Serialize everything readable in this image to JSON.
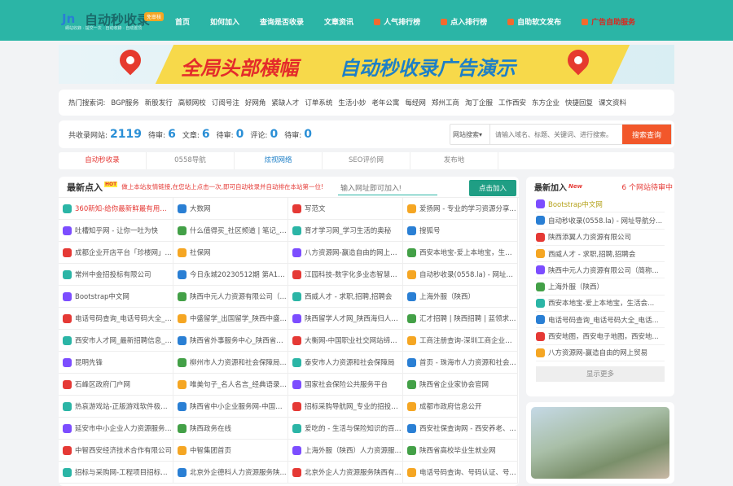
{
  "header": {
    "logo_text": "自动秒收录",
    "logo_badge": "免审核",
    "logo_slogan": "網站收錄 · 提交一次 · 自动收錄 · 自动置顶",
    "nav": [
      {
        "label": "首页",
        "icon": null
      },
      {
        "label": "如何加入",
        "icon": null
      },
      {
        "label": "查询是否收录",
        "icon": null
      },
      {
        "label": "文章资讯",
        "icon": null
      },
      {
        "label": "人气排行榜",
        "icon": "rss-icon"
      },
      {
        "label": "点入排行榜",
        "icon": "rss-icon"
      },
      {
        "label": "自助软文发布",
        "icon": "rss-icon"
      },
      {
        "label": "广告自助服务",
        "icon": "rss-icon",
        "color": "#e0241b"
      }
    ]
  },
  "banner": {
    "text1": "全局头部横幅",
    "text2": "自动秒收录广告演示"
  },
  "hot_search": {
    "label": "热门搜索词:",
    "terms": [
      "BGP服务",
      "新股发行",
      "高顿网校",
      "订阅号注",
      "好网角",
      "紧缺人才",
      "订单系统",
      "生活小妙",
      "老年公寓",
      "每经网",
      "郑州工商",
      "淘丁企服",
      "工作西安",
      "东方企业",
      "快捷回复",
      "课文资料"
    ]
  },
  "stats": {
    "sites_label": "共收录网站:",
    "sites": "2119",
    "pending1_label": "待审:",
    "pending1": "6",
    "articles_label": "文章:",
    "articles": "6",
    "pending2_label": "待审:",
    "pending2": "0",
    "comments_label": "评论:",
    "comments": "0",
    "pending3_label": "待审:",
    "pending3": "0"
  },
  "search": {
    "type": "网站搜索",
    "placeholder": "请输入域名、标题、关键词、进行搜索。",
    "button": "搜索查询"
  },
  "tabs": [
    "自动秒收录",
    "0558导航",
    "炫视网络",
    "SEO评价网",
    "发布地"
  ],
  "latest": {
    "title": "最新点入",
    "hot": "HOT",
    "tip": "做上本站友情链接,在您站上点击一次,即可自动收录并自动排在本站第一位!",
    "input_placeholder": "输入网址即可加入!",
    "add_button": "点击加入",
    "rows": [
      [
        "360新知-给你最新鲜最有用的...",
        "大数网",
        "写范文",
        "爱扬网 - 专业的学习资源分享..."
      ],
      [
        "吐槽知乎网 - 让你一吐为快",
        "什么值得买_社区频道 | 笔记_购...",
        "育才学习网_学习生活的奥秘",
        "搜狐号"
      ],
      [
        "成都企业开店平台「珍楼网」...",
        "社保网",
        "八方资源网-赢造自由的网上贸易",
        "西安本地宝-爱上本地宝，生活..."
      ],
      [
        "常州中金招投标有限公司",
        "今日永城20230512期 第A1版:...",
        "江园科技-数字化多业态智慧园区",
        "自动秒收录(0558.la) - 网址导..."
      ],
      [
        "Bootstrap中文网",
        "陕西中元人力资源有限公司（...",
        "西威人才 - 求职,招聘,招聘会",
        "上海外服（陕西）"
      ],
      [
        "电话号码查询_电话号码大全_电...",
        "中盛留学_出国留学_陕西中盛出...",
        "陕西留学人才网_陕西海归人才...",
        "汇才招聘 | 陕西招聘 | 蓝领求职..."
      ],
      [
        "西安市人才网_最新招聘信息_西...",
        "陕西省外事服务中心_陕西省国...",
        "大衡网-中国职业社交网站缔造者",
        "工商注册查询-深圳工商企业查..."
      ],
      [
        "昆明先锋",
        "柳州市人力资源和社会保障局...",
        "泰安市人力资源和社会保障局",
        "首页 - 珠海市人力资源和社会..."
      ],
      [
        "石峰区政府门户网",
        "唯美句子_名人名言_经典语录_...",
        "国家社会保险公共服务平台",
        "陕西省企业家协会官网"
      ],
      [
        "热哀游戏站-正版游戏软件极速...",
        "陕西省中小企业服务网-中国中...",
        "招标采购导航网_专业的招投标...",
        "成都市政府信息公开"
      ],
      [
        "延安市中小企业人力资源服务...",
        "陕西政务在线",
        "爱吃的 - 生活与保险知识的百...",
        "西安社保查询网 - 西安养老、..."
      ],
      [
        "中智西安经济技术合作有限公司",
        "中智集团首页",
        "上海外服（陕西）人力资源服...",
        "陕西省高校毕业生就业网"
      ],
      [
        "招标与采购网-工程项目招标采...",
        "北京外企德科人力资源服务陕...",
        "北京外企人力资源服务陕西有...",
        "电话号码查询、号码认证、号..."
      ]
    ]
  },
  "newest": {
    "title": "最新加入",
    "new_badge": "New",
    "pending": "6 个网站待审中",
    "items": [
      "Bootstrap中文网",
      "自动秒收录(0558.la) - 网址导航分...",
      "陕西添翼人力资源有限公司",
      "西威人才 - 求职,招聘,招聘会",
      "陕西中元人力资源有限公司（简称...",
      "上海外服（陕西）",
      "西安本地宝-爱上本地宝，生活会...",
      "电话号码查询_电话号码大全_电话...",
      "西安地图，西安电子地图，西安地...",
      "八方资源网-赢造自由的网上贸易"
    ],
    "more": "显示更多"
  },
  "colors": {
    "header": "#2bb5a6",
    "accent": "#f2572a",
    "add": "#1f9e84"
  }
}
